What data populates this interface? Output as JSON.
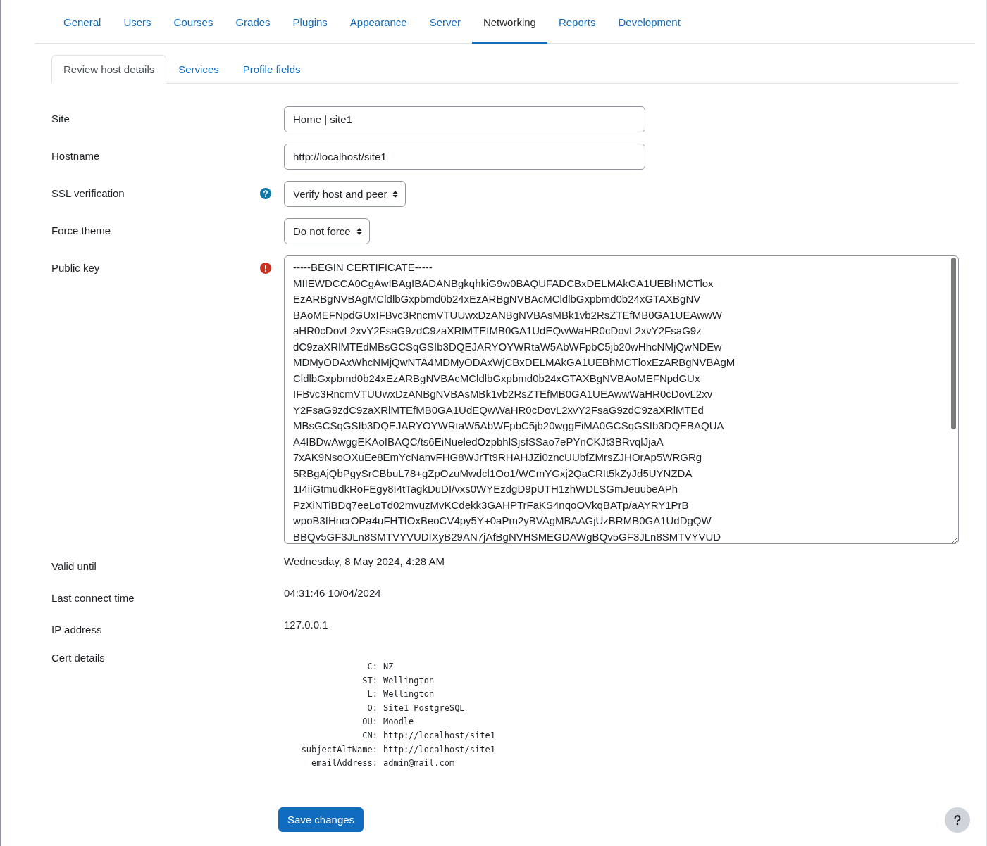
{
  "main_tabs": [
    {
      "label": "General",
      "selected": false
    },
    {
      "label": "Users",
      "selected": false
    },
    {
      "label": "Courses",
      "selected": false
    },
    {
      "label": "Grades",
      "selected": false
    },
    {
      "label": "Plugins",
      "selected": false
    },
    {
      "label": "Appearance",
      "selected": false
    },
    {
      "label": "Server",
      "selected": false
    },
    {
      "label": "Networking",
      "selected": true
    },
    {
      "label": "Reports",
      "selected": false
    },
    {
      "label": "Development",
      "selected": false
    }
  ],
  "sub_tabs": [
    {
      "label": "Review host details",
      "selected": true
    },
    {
      "label": "Services",
      "selected": false
    },
    {
      "label": "Profile fields",
      "selected": false
    }
  ],
  "form": [
    {
      "kind": "text",
      "label": "Site",
      "value": "Home | site1"
    },
    {
      "kind": "text",
      "label": "Hostname",
      "value": "http://localhost/site1"
    },
    {
      "kind": "select",
      "label": "SSL verification",
      "value": "Verify host and peer",
      "help": true
    },
    {
      "kind": "select",
      "label": "Force theme",
      "value": "Do not force"
    },
    {
      "kind": "textarea",
      "label": "Public key",
      "error": true,
      "lines": [
        "-----BEGIN CERTIFICATE-----",
        "MIIEWDCCA0CgAwIBAgIBADANBgkqhkiG9w0BAQUFADCBxDELMAkGA1UEBhMCTlox",
        "EzARBgNVBAgMCldlbGxpbmd0b24xEzARBgNVBAcMCldlbGxpbmd0b24xGTAXBgNV",
        "BAoMEFNpdGUxIFBvc3RncmVTUUwxDzANBgNVBAsMBk1vb2RsZTEfMB0GA1UEAwwW",
        "aHR0cDovL2xvY2FsaG9zdC9zaXRlMTEfMB0GA1UdEQwWaHR0cDovL2xvY2FsaG9z",
        "dC9zaXRlMTEdMBsGCSqGSIb3DQEJARYOYWRtaW5AbWFpbC5jb20wHhcNMjQwNDEw",
        "MDMyODAxWhcNMjQwNTA4MDMyODAxWjCBxDELMAkGA1UEBhMCTloxEzARBgNVBAgM",
        "CldlbGxpbmd0b24xEzARBgNVBAcMCldlbGxpbmd0b24xGTAXBgNVBAoMEFNpdGUx",
        "IFBvc3RncmVTUUwxDzANBgNVBAsMBk1vb2RsZTEfMB0GA1UEAwwWaHR0cDovL2xv",
        "Y2FsaG9zdC9zaXRlMTEfMB0GA1UdEQwWaHR0cDovL2xvY2FsaG9zdC9zaXRlMTEd",
        "MBsGCSqGSIb3DQEJARYOYWRtaW5AbWFpbC5jb20wggEiMA0GCSqGSIb3DQEBAQUA",
        "A4IBDwAwggEKAoIBAQC/ts6EiNueledOzpbhlSjsfSSao7ePYnCKJt3BRvqlJjaA",
        "7xAK9NsoOXuEe8EmYcNanvFHG8WJrTt9RHAHJZi0zncUUbfZMrsZJHOrAp5WRGRg",
        "5RBgAjQbPgySrCBbuL78+gZpOzuMwdcl1Oo1/WCmYGxj2QaCRIt5kZyJd5UYNZDA",
        "1I4iiGtmudkRoFEgy8I4tTagkDuDI/vxs0WYEzdgD9pUTH1zhWDLSGmJeuubeAPh",
        "PzXiNTiBDq7eeLoTd02mvuzMvKCdekk3GAHPTrFaKS4nqoOVkqBATp/aAYRY1PrB",
        "wpoB3fHncrOPa4uFHTfOxBeoCV4py5Y+0aPm2yBVAgMBAAGjUzBRMB0GA1UdDgQW",
        "BBQv5GF3JLn8SMTVYVUDIXyB29AN7jAfBgNVHSMEGDAWgBQv5GF3JLn8SMTVYVUD"
      ]
    },
    {
      "kind": "static",
      "label": "Valid until",
      "value": "Wednesday, 8 May 2024, 4:28 AM"
    },
    {
      "kind": "static",
      "label": "Last connect time",
      "value": "04:31:46 10/04/2024"
    },
    {
      "kind": "static",
      "label": "IP address",
      "value": "127.0.0.1"
    },
    {
      "kind": "cert",
      "label": "Cert details",
      "entries": [
        {
          "key": "C:",
          "value": "NZ"
        },
        {
          "key": "ST:",
          "value": "Wellington"
        },
        {
          "key": "L:",
          "value": "Wellington"
        },
        {
          "key": "O:",
          "value": "Site1 PostgreSQL"
        },
        {
          "key": "OU:",
          "value": "Moodle"
        },
        {
          "key": "CN:",
          "value": "http://localhost/site1"
        },
        {
          "key": "subjectAltName:",
          "value": "http://localhost/site1"
        },
        {
          "key": "emailAddress:",
          "value": "admin@mail.com"
        }
      ]
    }
  ],
  "save_button": "Save changes"
}
